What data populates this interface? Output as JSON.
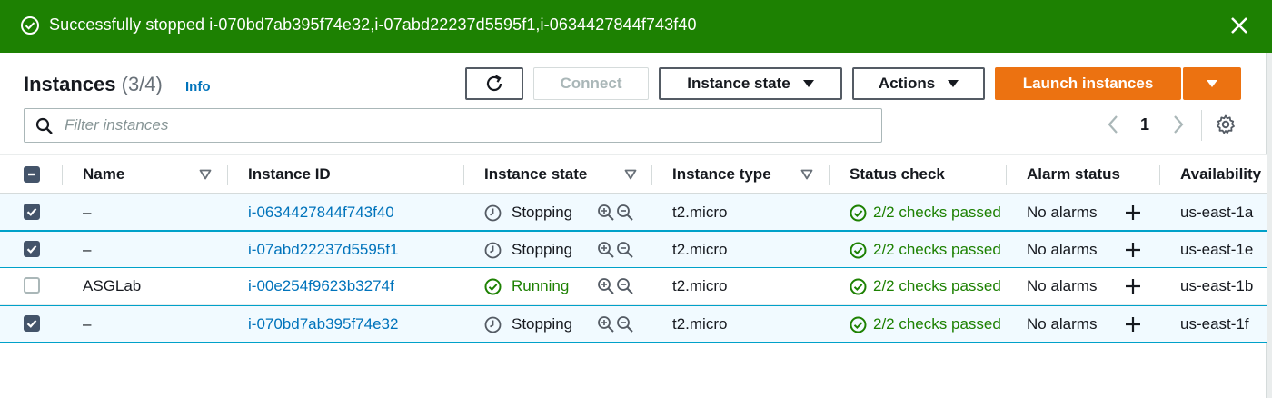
{
  "flash": {
    "message": "Successfully stopped i-070bd7ab395f74e32,i-07abd22237d5595f1,i-0634427844f743f40"
  },
  "header": {
    "title": "Instances",
    "count": "(3/4)",
    "info_label": "Info"
  },
  "toolbar": {
    "connect_label": "Connect",
    "instance_state_label": "Instance state",
    "actions_label": "Actions",
    "launch_label": "Launch instances"
  },
  "search": {
    "placeholder": "Filter instances",
    "value": ""
  },
  "pagination": {
    "current_page": "1"
  },
  "table": {
    "columns": [
      "Name",
      "Instance ID",
      "Instance state",
      "Instance type",
      "Status check",
      "Alarm status",
      "Availability"
    ],
    "rows": [
      {
        "selected": true,
        "name": "–",
        "instance_id": "i-0634427844f743f40",
        "state": "Stopping",
        "type": "t2.micro",
        "status_check": "2/2 checks passed",
        "alarm": "No alarms",
        "az": "us-east-1a"
      },
      {
        "selected": true,
        "name": "–",
        "instance_id": "i-07abd22237d5595f1",
        "state": "Stopping",
        "type": "t2.micro",
        "status_check": "2/2 checks passed",
        "alarm": "No alarms",
        "az": "us-east-1e"
      },
      {
        "selected": false,
        "name": "ASGLab",
        "instance_id": "i-00e254f9623b3274f",
        "state": "Running",
        "type": "t2.micro",
        "status_check": "2/2 checks passed",
        "alarm": "No alarms",
        "az": "us-east-1b"
      },
      {
        "selected": true,
        "name": "–",
        "instance_id": "i-070bd7ab395f74e32",
        "state": "Stopping",
        "type": "t2.micro",
        "status_check": "2/2 checks passed",
        "alarm": "No alarms",
        "az": "us-east-1f"
      }
    ]
  },
  "colors": {
    "flash_success": "#1d8102",
    "primary_button": "#ec7211",
    "link": "#0073bb",
    "status_ok": "#1d8102",
    "selected_row": "#f1faff",
    "selected_border": "#00a1c9"
  },
  "icons": [
    "success-check-icon",
    "close-icon",
    "refresh-icon",
    "caret-down-icon",
    "search-icon",
    "chevron-left-icon",
    "chevron-right-icon",
    "gear-icon",
    "sort-icon",
    "clock-icon",
    "running-check-icon",
    "zoom-in-icon",
    "zoom-out-icon",
    "checks-passed-icon",
    "plus-icon"
  ]
}
